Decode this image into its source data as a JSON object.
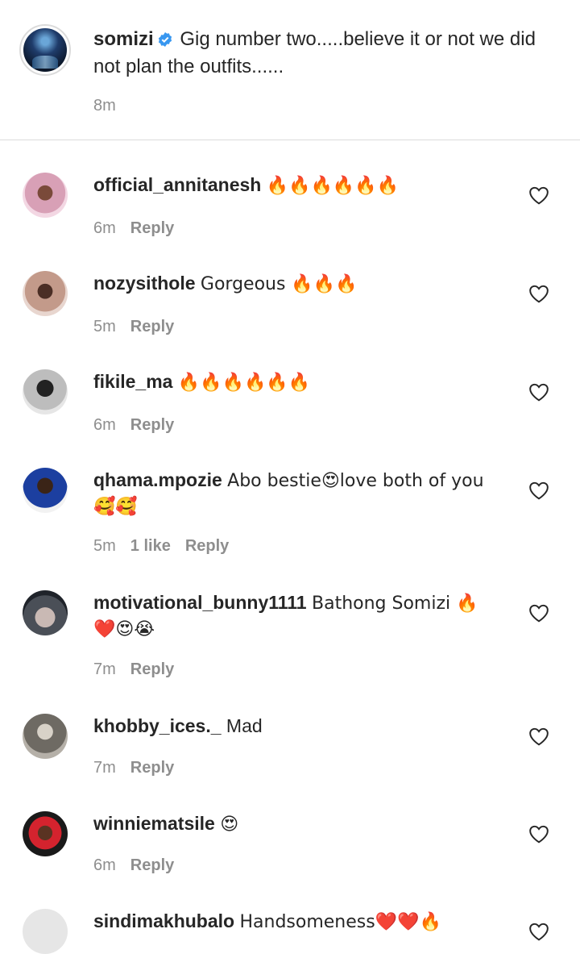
{
  "caption": {
    "username": "somizi",
    "text": "Gig number two.....believe it or not we did not plan the outfits......",
    "time": "8m"
  },
  "comments": [
    {
      "username": "official_annitanesh",
      "text": "🔥🔥🔥🔥🔥🔥",
      "time": "6m",
      "likes": "",
      "reply": "Reply"
    },
    {
      "username": "nozysithole",
      "text": "Gorgeous 🔥🔥🔥",
      "time": "5m",
      "likes": "",
      "reply": "Reply"
    },
    {
      "username": "fikile_ma",
      "text": "🔥🔥🔥🔥🔥🔥",
      "time": "6m",
      "likes": "",
      "reply": "Reply"
    },
    {
      "username": "qhama.mpozie",
      "text": "Abo bestie😍love both of you 🥰🥰",
      "time": "5m",
      "likes": "1 like",
      "reply": "Reply"
    },
    {
      "username": "motivational_bunny1111",
      "text": "Bathong Somizi 🔥 ❤️😍😭",
      "time": "7m",
      "likes": "",
      "reply": "Reply"
    },
    {
      "username": "khobby_ices._",
      "text": "Mad",
      "time": "7m",
      "likes": "",
      "reply": "Reply"
    },
    {
      "username": "winniematsile",
      "text": "😍",
      "time": "6m",
      "likes": "",
      "reply": "Reply"
    },
    {
      "username": "sindimakhubalo",
      "text": "Handsomeness❤️❤️🔥",
      "time": "",
      "likes": "",
      "reply": ""
    }
  ],
  "icons": {
    "verified": "verified-badge-icon",
    "like": "heart-outline-icon"
  },
  "colors": {
    "verified": "#3897f0",
    "muted": "#8e8e8e",
    "text": "#262626"
  }
}
